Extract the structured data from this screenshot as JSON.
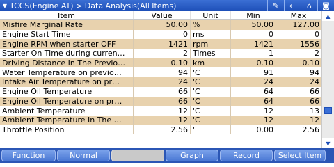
{
  "window": {
    "title": "TCCS(Engine AT) > Data Analysis(All Items)"
  },
  "columns": {
    "item": "Item",
    "value": "Value",
    "unit": "Unit",
    "min": "Min",
    "max": "Max"
  },
  "rows": [
    {
      "item": "Misfire Marginal Rate",
      "value": "50.00",
      "unit": "%",
      "min": "50.00",
      "max": "127.00"
    },
    {
      "item": "Engine Start Time",
      "value": "0",
      "unit": "ms",
      "min": "0",
      "max": "0"
    },
    {
      "item": "Engine RPM when starter OFF",
      "value": "1421",
      "unit": "rpm",
      "min": "1421",
      "max": "1556"
    },
    {
      "item": "Starter On Time during curren…",
      "value": "2",
      "unit": "Times",
      "min": "1",
      "max": "2"
    },
    {
      "item": "Driving Distance In The Previo…",
      "value": "0.10",
      "unit": "km",
      "min": "0.10",
      "max": "0.10"
    },
    {
      "item": "Water Temperature on previo…",
      "value": "94",
      "unit": "'C",
      "min": "91",
      "max": "94"
    },
    {
      "item": "Intake Air Temperature on pr…",
      "value": "24",
      "unit": "'C",
      "min": "24",
      "max": "24"
    },
    {
      "item": "Engine Oil Temperature",
      "value": "66",
      "unit": "'C",
      "min": "64",
      "max": "66"
    },
    {
      "item": "Engine Oil Temperature on pr…",
      "value": "66",
      "unit": "'C",
      "min": "64",
      "max": "66"
    },
    {
      "item": "Ambient Temperature",
      "value": "12",
      "unit": "'C",
      "min": "12",
      "max": "13"
    },
    {
      "item": "Ambient Temperature In The …",
      "value": "12",
      "unit": "'C",
      "min": "12",
      "max": "12"
    },
    {
      "item": "Throttle Position",
      "value": "2.56",
      "unit": "'",
      "min": "0.00",
      "max": "2.56"
    }
  ],
  "buttons": {
    "function": "Function",
    "normal": "Normal",
    "blank": "",
    "graph": "Graph",
    "record": "Record",
    "select_item": "Select Item"
  },
  "icons": {
    "title_arrow": "triangle-down-icon",
    "edit": "pencil-icon",
    "back": "back-arrow-icon",
    "home": "home-icon",
    "camera": "camera-icon"
  },
  "colors": {
    "title_bar": "#1d4fb8",
    "row_highlight": "#e8d2ae",
    "button_bar": "#2b56b5"
  }
}
